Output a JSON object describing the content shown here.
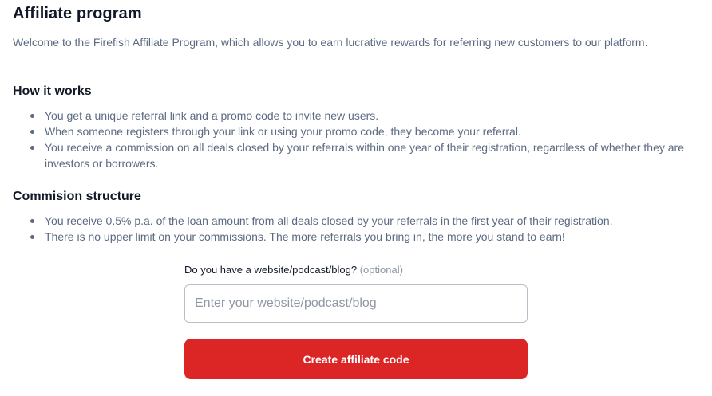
{
  "page": {
    "title": "Affiliate program",
    "intro": "Welcome to the Firefish Affiliate Program, which allows you to earn lucrative rewards for referring new customers to our platform."
  },
  "how_it_works": {
    "title": "How it works",
    "items": [
      "You get a unique referral link and a promo code to invite new users.",
      "When someone registers through your link or using your promo code, they become your referral.",
      "You receive a commission on all deals closed by your referrals within one year of their registration, regardless of whether they are investors or borrowers."
    ]
  },
  "commission": {
    "title": "Commision structure",
    "items": [
      "You receive 0.5% p.a. of the loan amount from all deals closed by your referrals in the first year of their registration.",
      "There is no upper limit on your commissions. The more referrals you bring in, the more you stand to earn!"
    ]
  },
  "form": {
    "label": "Do you have a website/podcast/blog?",
    "optional_label": "(optional)",
    "website_value": "",
    "website_placeholder": "Enter your website/podcast/blog",
    "submit_label": "Create affiliate code"
  },
  "colors": {
    "primary_button": "#dc2626",
    "heading_text": "#111827",
    "body_text": "#5b6b82"
  }
}
